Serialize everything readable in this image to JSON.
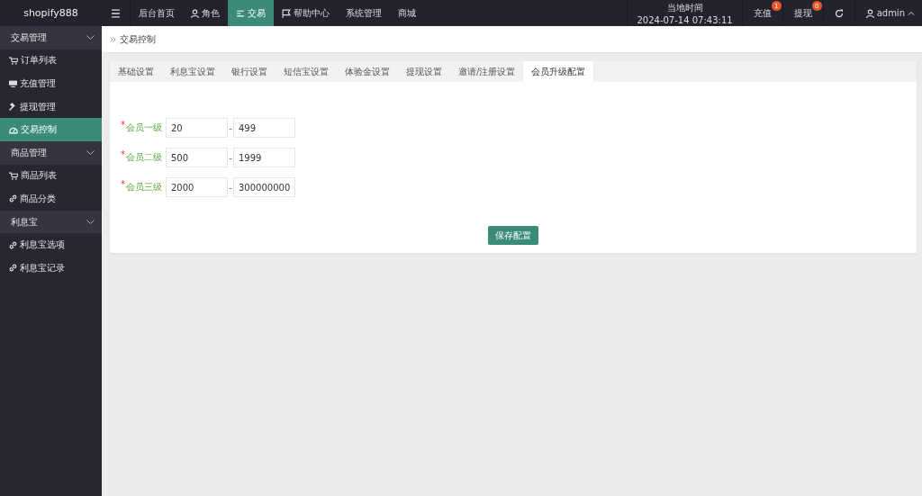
{
  "brand": "shopify888",
  "top_nav": [
    {
      "label": "后台首页",
      "selected": false
    },
    {
      "label": "角色",
      "selected": false
    },
    {
      "label": "交易",
      "selected": true
    },
    {
      "label": "帮助中心",
      "selected": false
    },
    {
      "label": "系统管理",
      "selected": false
    },
    {
      "label": "商城",
      "selected": false
    }
  ],
  "clock": {
    "label": "当地时间",
    "time": "2024-07-14 07:43:11"
  },
  "top_actions": [
    {
      "label": "充值",
      "badge": "1"
    },
    {
      "label": "提现",
      "badge": "0"
    }
  ],
  "user": "admin",
  "sidebar": [
    {
      "label": "交易管理",
      "expanded": true,
      "children": [
        {
          "label": "订单列表",
          "selected": false
        },
        {
          "label": "充值管理",
          "selected": false
        },
        {
          "label": "提现管理",
          "selected": false
        },
        {
          "label": "交易控制",
          "selected": true
        }
      ]
    },
    {
      "label": "商品管理",
      "expanded": true,
      "children": [
        {
          "label": "商品列表",
          "selected": false
        },
        {
          "label": "商品分类",
          "selected": false
        }
      ]
    },
    {
      "label": "利息宝",
      "expanded": true,
      "children": [
        {
          "label": "利息宝选项",
          "selected": false
        },
        {
          "label": "利息宝记录",
          "selected": false
        }
      ]
    }
  ],
  "breadcrumb": "交易控制",
  "tabs": [
    {
      "label": "基础设置",
      "selected": false
    },
    {
      "label": "利息宝设置",
      "selected": false
    },
    {
      "label": "银行设置",
      "selected": false
    },
    {
      "label": "短信宝设置",
      "selected": false
    },
    {
      "label": "体验金设置",
      "selected": false
    },
    {
      "label": "提现设置",
      "selected": false
    },
    {
      "label": "邀请/注册设置",
      "selected": false
    },
    {
      "label": "会员升级配置",
      "selected": true
    }
  ],
  "levels": [
    {
      "required_mark": "*",
      "label": "会员一级",
      "min": "20",
      "dash": "-",
      "max": "499"
    },
    {
      "required_mark": "*",
      "label": "会员二级",
      "min": "500",
      "dash": "-",
      "max": "1999"
    },
    {
      "required_mark": "*",
      "label": "会员三级",
      "min": "2000",
      "dash": "-",
      "max": "300000000"
    }
  ],
  "save_button": "保存配置"
}
